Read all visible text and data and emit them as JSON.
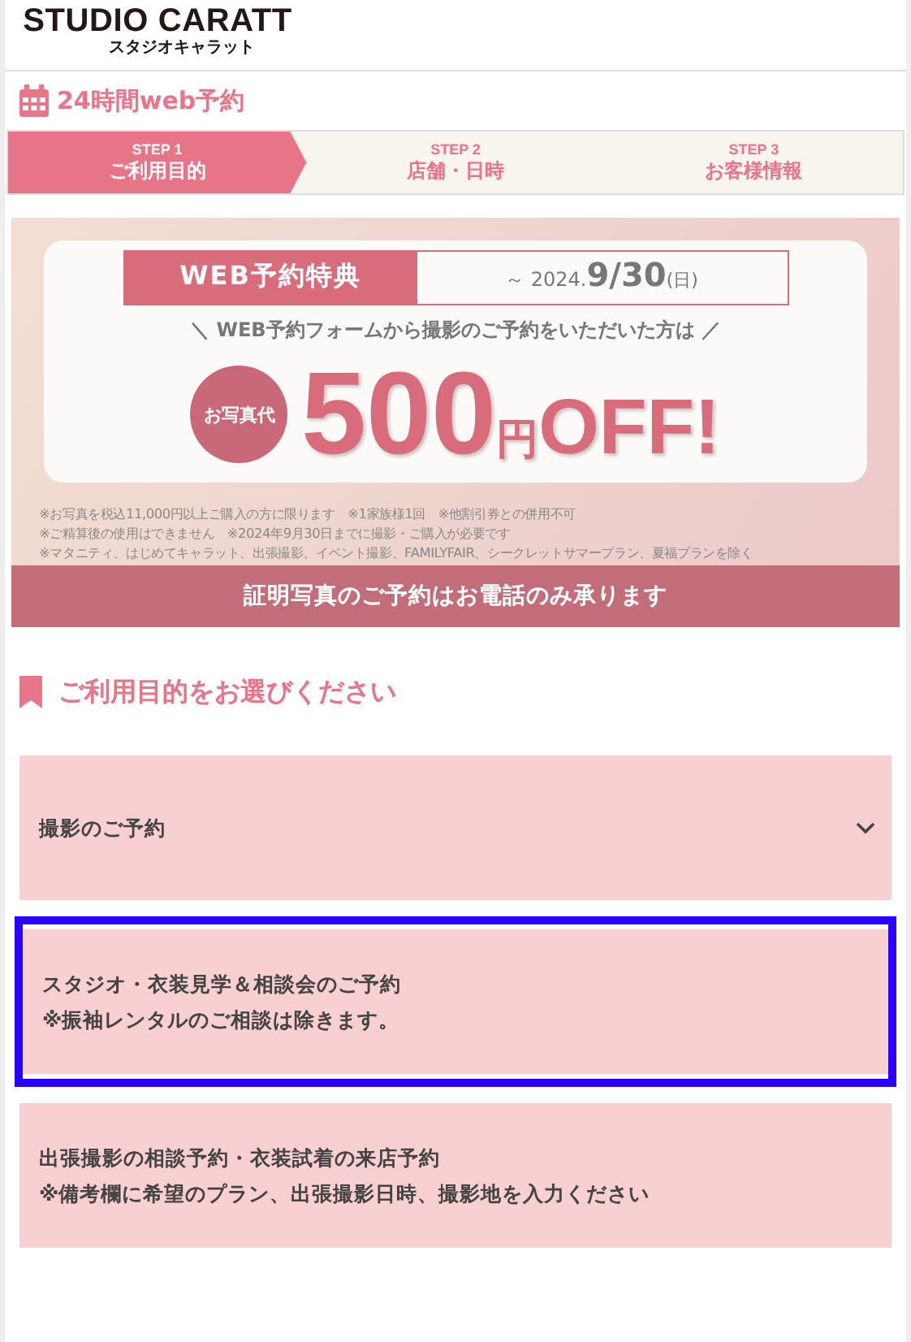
{
  "logo": {
    "title": "STUDIO CARATT",
    "subtitle": "スタジオキャラット"
  },
  "page_title": "24時間web予約",
  "steps": [
    {
      "step": "STEP 1",
      "label": "ご利用目的",
      "selected": true
    },
    {
      "step": "STEP 2",
      "label": "店舗・日時",
      "selected": false
    },
    {
      "step": "STEP 3",
      "label": "お客様情報",
      "selected": false
    }
  ],
  "banner": {
    "tag": "WEB予約特典",
    "period_prefix": "～ 2024.",
    "period_date": "9/30",
    "period_day": "(日)",
    "lead": "＼ WEB予約フォームから撮影のご予約をいただいた方は ／",
    "badge": "お写真代",
    "amount": "500",
    "unit": "円",
    "off": "OFF!",
    "notes": [
      "※お写真を税込11,000円以上ご購入の方に限ります　※1家族様1回　※他割引券との併用不可",
      "※ご精算後の使用はできません　※2024年9月30日までに撮影・ご購入が必要です",
      "※マタニティ、はじめてキャラット、出張撮影、イベント撮影、FAMILYFAIR、シークレットサマープラン、夏福プランを除く"
    ],
    "bar": "証明写真のご予約はお電話のみ承ります"
  },
  "section_heading": "ご利用目的をお選びください",
  "options": [
    {
      "kind": "dropdown",
      "lines": [
        "撮影のご予約"
      ],
      "selected": false
    },
    {
      "kind": "plain",
      "lines": [
        "スタジオ・衣装見学＆相談会のご予約",
        "※振袖レンタルのご相談は除きます。"
      ],
      "selected": true
    },
    {
      "kind": "plain",
      "lines": [
        "出張撮影の相談予約・衣装試着の来店予約",
        "※備考欄に希望のプラン、出張撮影日時、撮影地を入力ください"
      ],
      "selected": false
    }
  ]
}
